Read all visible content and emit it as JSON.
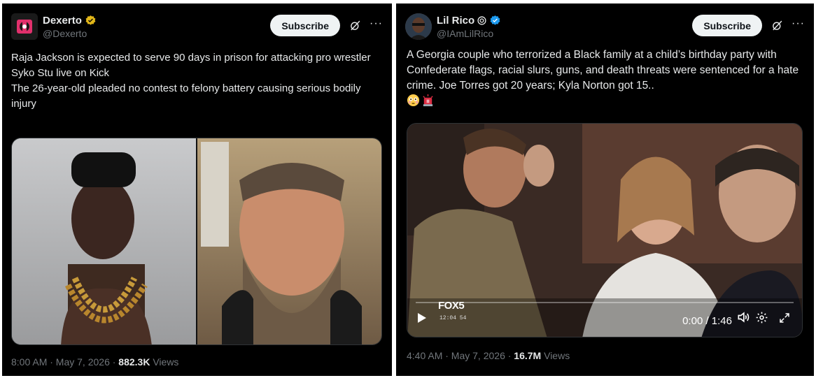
{
  "tweets": [
    {
      "author": {
        "name": "Dexerto",
        "handle": "@Dexerto",
        "verified": "gold-check"
      },
      "subscribe_label": "Subscribe",
      "text": [
        "Raja Jackson is expected to serve 90 days in prison for attacking pro wrestler Syko Stu live on Kick",
        "The 26-year-old pleaded no contest to felony battery causing serious bodily injury"
      ],
      "timestamp": "8:00 AM · May 7, 2026 · ",
      "views_count": "882.3K",
      "views_label": " Views"
    },
    {
      "author": {
        "name": "Lil Rico",
        "handle": "@IAmLilRico",
        "verified": "blue-check"
      },
      "subscribe_label": "Subscribe",
      "text": [
        "A Georgia couple who terrorized a Black family at a child’s birthday party with Confederate flags, racial slurs, guns, and death threats were sentenced for a hate crime. Joe Torres got 20 years; Kyla Norton got 15.."
      ],
      "emojis": [
        "flushed-face",
        "police-light"
      ],
      "video": {
        "time": "0:00 / 1:46",
        "channel_logo": "FOX5",
        "channel_time": "12:04  54"
      },
      "timestamp": "4:40 AM · May 7, 2026 · ",
      "views_count": "16.7M",
      "views_label": " Views"
    }
  ],
  "colors": {
    "background": "#000000",
    "text": "#e7e9ea",
    "muted": "#71767b",
    "gold": "#e2b719",
    "blue": "#1d9bf0"
  }
}
